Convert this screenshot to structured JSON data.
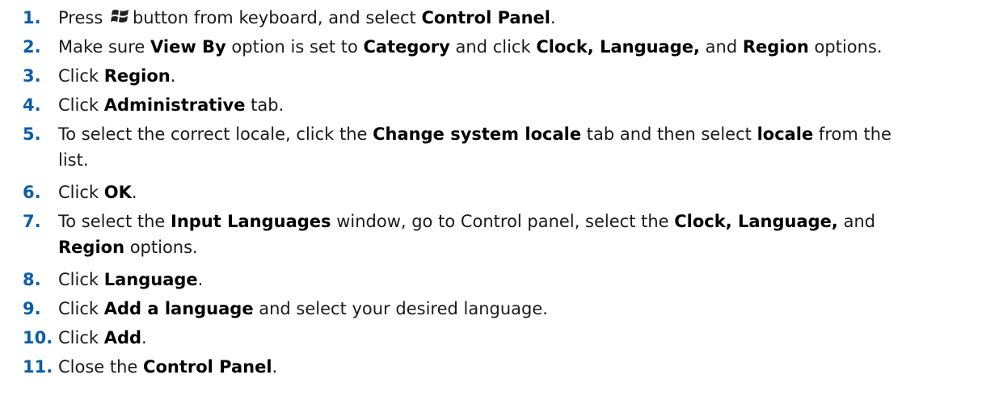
{
  "steps": [
    {
      "num": "1.",
      "parts": [
        "Press ",
        "button from keyboard, and select ",
        "Control Panel",
        "."
      ]
    },
    {
      "num": "2.",
      "parts": [
        "Make sure ",
        "View By",
        " option is set to ",
        "Category",
        " and click ",
        "Clock, Language,",
        " and ",
        "Region",
        " options."
      ]
    },
    {
      "num": "3.",
      "parts": [
        "Click ",
        "Region",
        "."
      ]
    },
    {
      "num": "4.",
      "parts": [
        "Click ",
        "Administrative",
        " tab."
      ]
    },
    {
      "num": "5.",
      "parts": [
        "To select the correct locale, click the ",
        "Change system locale",
        " tab and then select ",
        "locale",
        " from the",
        "list."
      ]
    },
    {
      "num": "6.",
      "parts": [
        "Click ",
        "OK",
        "."
      ]
    },
    {
      "num": "7.",
      "parts": [
        "To select the ",
        "Input Languages",
        " window, go to Control panel, select the ",
        "Clock, Language,",
        " and",
        "Region",
        " options."
      ]
    },
    {
      "num": "8.",
      "parts": [
        "Click ",
        "Language",
        "."
      ]
    },
    {
      "num": "9.",
      "parts": [
        "Click ",
        "Add a language",
        " and select your desired language."
      ]
    },
    {
      "num": "10.",
      "parts": [
        "Click ",
        "Add",
        "."
      ]
    },
    {
      "num": "11.",
      "parts": [
        "Close the ",
        "Control Panel",
        "."
      ]
    }
  ],
  "icons": {
    "windows_key": "windows-logo-icon"
  },
  "colors": {
    "number": "#0b5ea8",
    "text": "#1a1a1a"
  }
}
